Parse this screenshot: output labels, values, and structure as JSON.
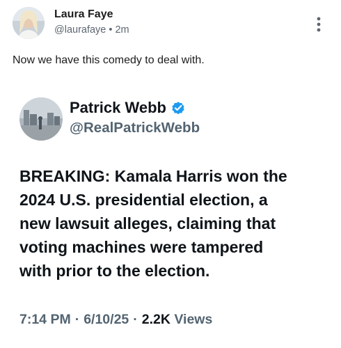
{
  "post": {
    "author_name": "Laura Faye",
    "handle": "@laurafaye",
    "separator": "•",
    "time_ago": "2m",
    "text": "Now we have this comedy to deal with."
  },
  "icons": {
    "more": "vertical-ellipsis-icon",
    "verified": "verified-badge-icon",
    "verified_color": "#1d9bf0"
  },
  "quoted_tweet": {
    "name": "Patrick Webb",
    "handle": "@RealPatrickWebb",
    "body_lines": [
      "BREAKING: Kamala Harris won the",
      "2024 U.S. presidential election, a",
      "new lawsuit alleges, claiming that",
      "voting machines were tampered",
      "with prior to the election."
    ],
    "time": "7:14 PM",
    "date": "6/10/25",
    "separator": "·",
    "views_count": "2.2K",
    "views_label": "Views"
  }
}
